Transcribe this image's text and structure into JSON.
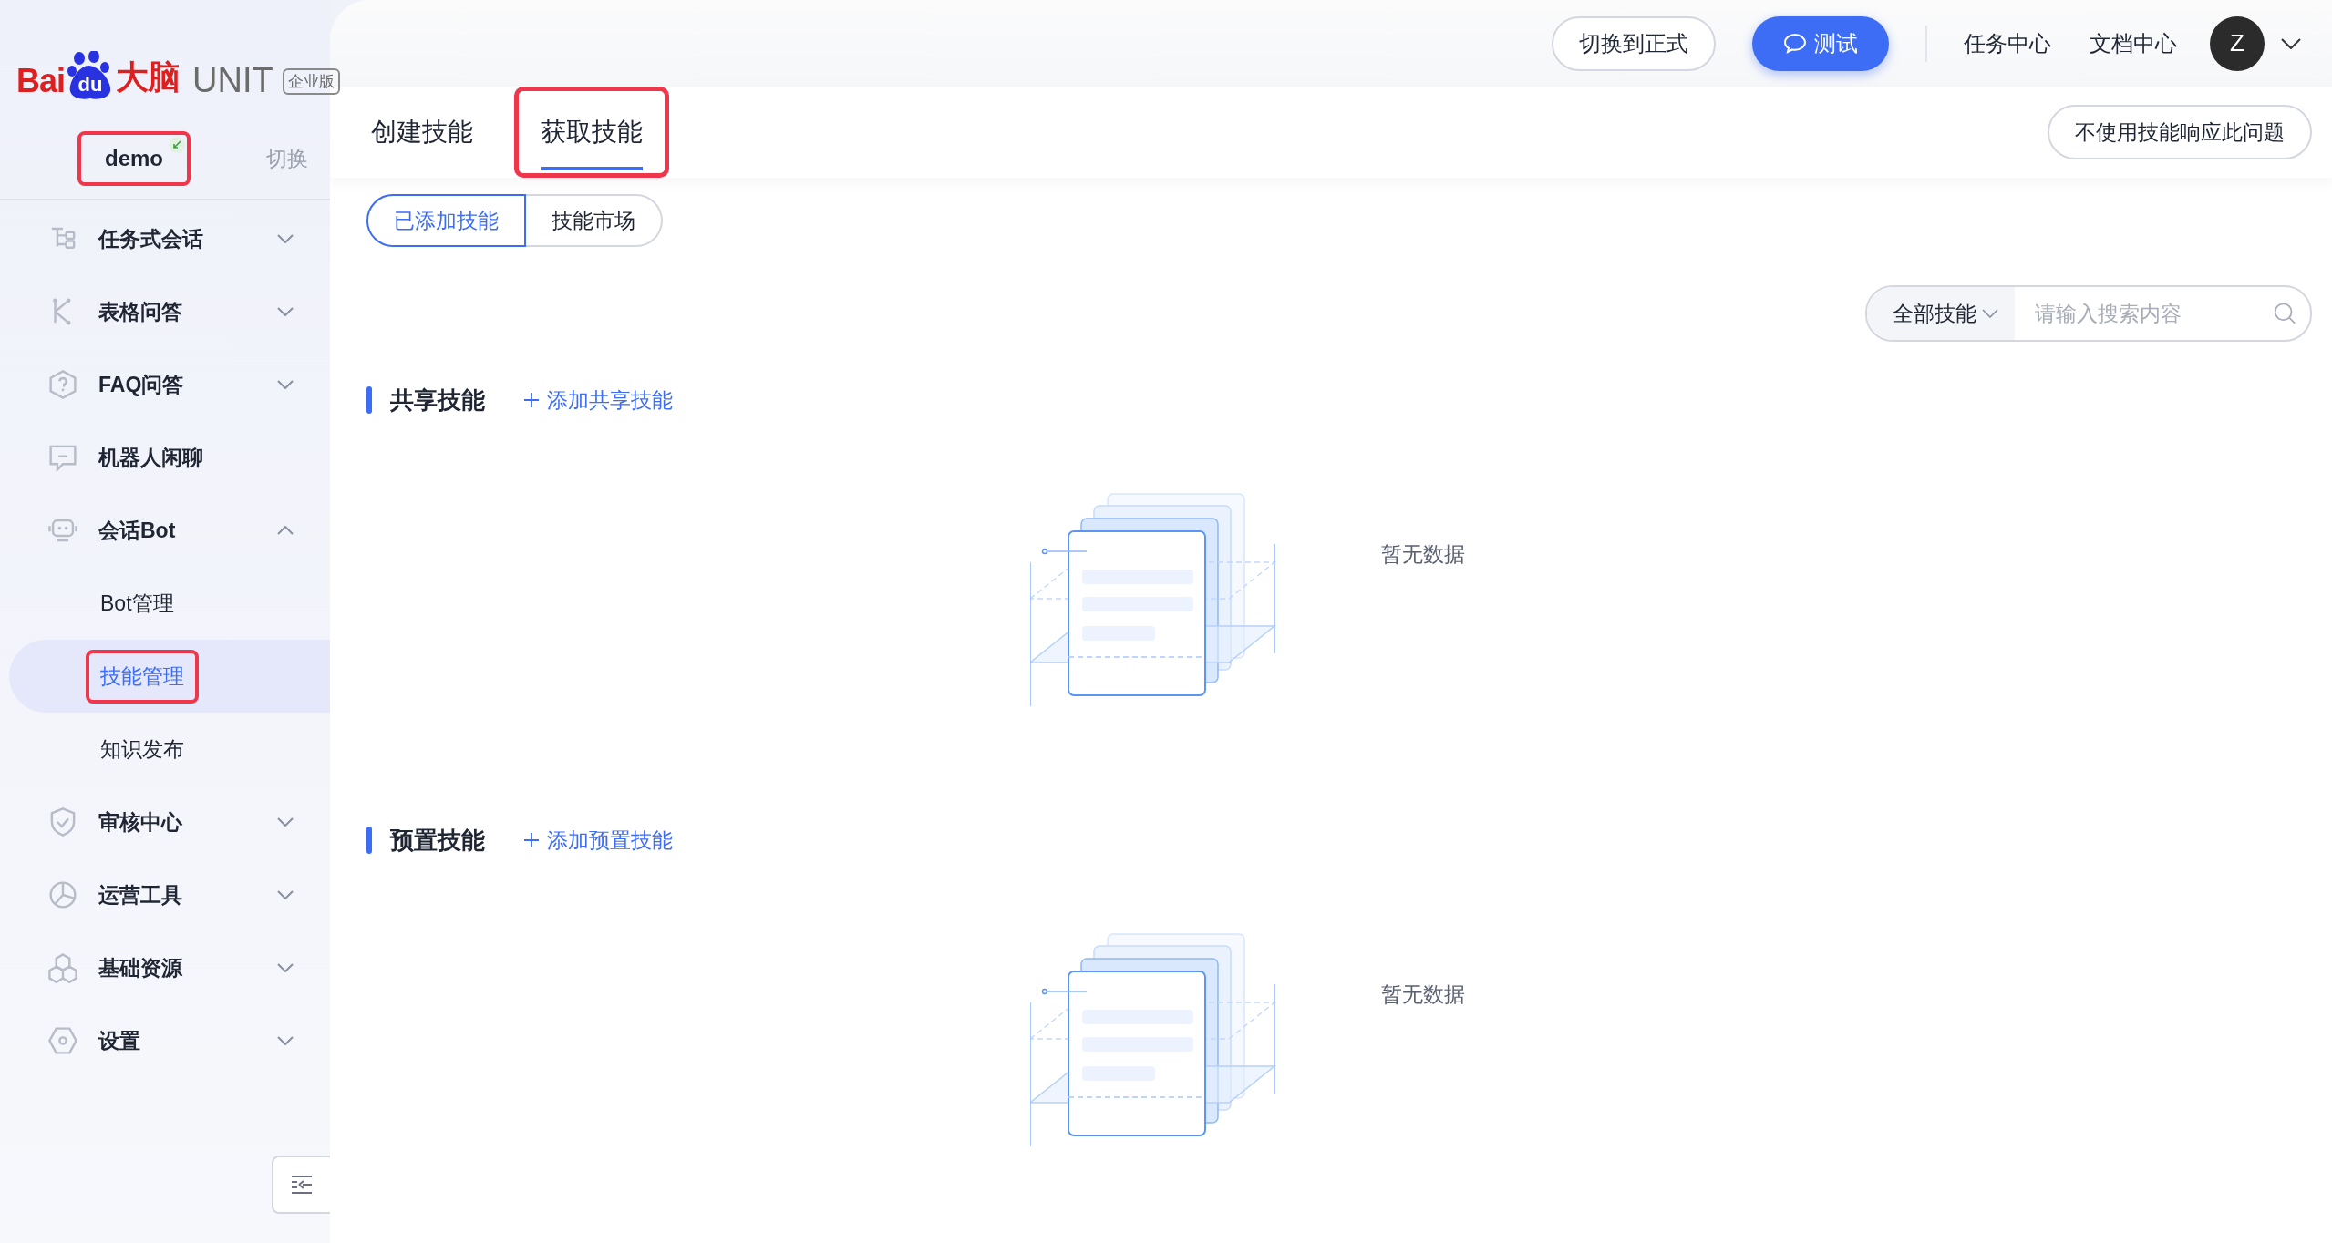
{
  "logo": {
    "text_left": "Bai",
    "paw_text": "du",
    "text_right": "大脑",
    "product": "UNIT",
    "edition": "企业版"
  },
  "bot": {
    "name": "demo",
    "highlighted": true,
    "switch": "切换"
  },
  "sidebar": {
    "items": [
      {
        "label": "任务式会话",
        "kind": "group",
        "expanded": false
      },
      {
        "label": "表格问答",
        "kind": "group",
        "expanded": false
      },
      {
        "label": "FAQ问答",
        "kind": "group",
        "expanded": false
      },
      {
        "label": "机器人闲聊",
        "kind": "link"
      },
      {
        "label": "会话Bot",
        "kind": "group",
        "expanded": true,
        "children": [
          {
            "label": "Bot管理",
            "selected": false,
            "highlighted": false
          },
          {
            "label": "技能管理",
            "selected": true,
            "highlighted": true
          },
          {
            "label": "知识发布",
            "selected": false,
            "highlighted": false
          }
        ]
      },
      {
        "label": "审核中心",
        "kind": "group",
        "expanded": false
      },
      {
        "label": "运营工具",
        "kind": "group",
        "expanded": false
      },
      {
        "label": "基础资源",
        "kind": "group",
        "expanded": false
      },
      {
        "label": "设置",
        "kind": "group",
        "expanded": false
      }
    ]
  },
  "header": {
    "buttons": [
      {
        "label": "切换到正式",
        "kind": "outline"
      },
      {
        "label": "测试",
        "kind": "primary"
      }
    ],
    "links": [
      "任务中心",
      "文档中心"
    ],
    "avatar": "Z"
  },
  "tabs": [
    {
      "label": "创建技能",
      "selected": false,
      "highlighted": false
    },
    {
      "label": "获取技能",
      "selected": true,
      "highlighted": true
    }
  ],
  "action_button": "不使用技能响应此问题",
  "segments": [
    {
      "label": "已添加技能",
      "selected": true
    },
    {
      "label": "技能市场",
      "selected": false
    }
  ],
  "filter": {
    "dropdown": "全部技能",
    "placeholder": "请输入搜索内容"
  },
  "sections": [
    {
      "title": "共享技能",
      "add_link": "添加共享技能",
      "empty_text": "暂无数据"
    },
    {
      "title": "预置技能",
      "add_link": "添加预置技能",
      "empty_text": "暂无数据"
    }
  ]
}
